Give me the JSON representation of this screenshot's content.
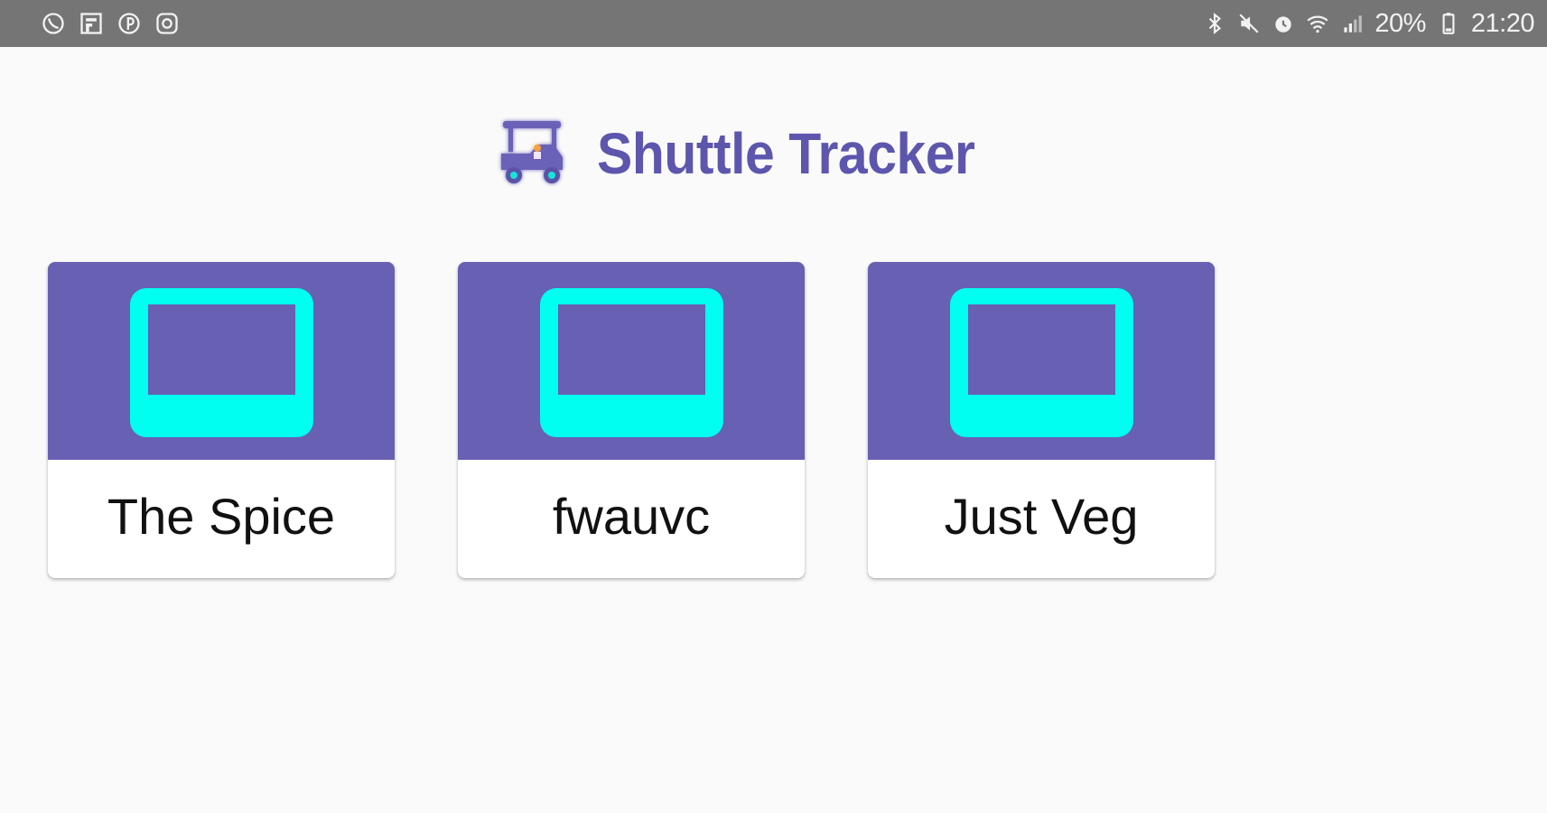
{
  "status_bar": {
    "left_icons": [
      "viber-icon",
      "flipboard-icon",
      "pinterest-icon",
      "instagram-icon"
    ],
    "right_icons": [
      "bluetooth-icon",
      "mute-icon",
      "alarm-icon",
      "wifi-icon",
      "signal-icon",
      "battery-icon"
    ],
    "battery": "20%",
    "time": "21:20"
  },
  "header": {
    "logo_icon": "golf-cart-icon",
    "title": "Shuttle Tracker"
  },
  "colors": {
    "accent": "#5d56ad",
    "card_top": "#6760b3",
    "screen_icon": "#00fff0",
    "status_bar": "#757575",
    "background": "#fafafa"
  },
  "restaurants": [
    {
      "name": "The Spice",
      "icon": "screen-icon"
    },
    {
      "name": "fwauvc",
      "icon": "screen-icon"
    },
    {
      "name": "Just Veg",
      "icon": "screen-icon"
    }
  ]
}
